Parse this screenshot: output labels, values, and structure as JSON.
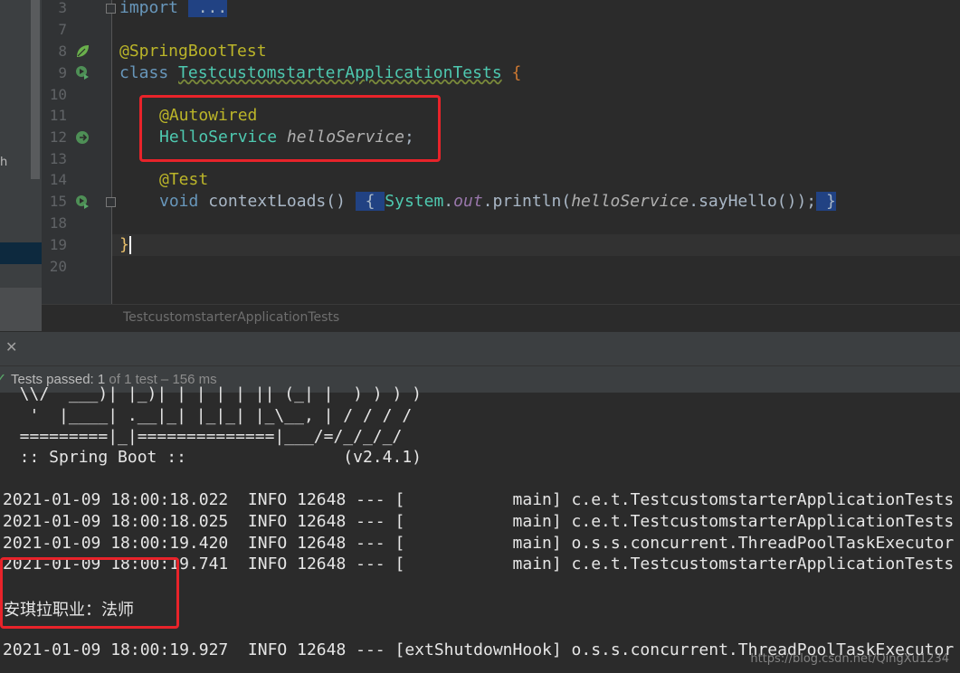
{
  "editor": {
    "line_numbers": [
      "3",
      "7",
      "8",
      "9",
      "10",
      "11",
      "12",
      "13",
      "14",
      "15",
      "18",
      "19",
      "20"
    ],
    "lines": {
      "import_kw": "import",
      "import_fold": " ...",
      "annotation_springboottest": "@SpringBootTest",
      "class_kw": "class",
      "class_name": "TestcustomstarterApplicationTests",
      "class_open": " {",
      "annotation_autowired": "@Autowired",
      "field_type": "HelloService",
      "field_name": "helloService",
      "field_semicolon": ";",
      "annotation_test": "@Test",
      "method_kw": "void",
      "method_sig": " contextLoads() ",
      "body_open": " { ",
      "system": "System",
      "dot1": ".",
      "out": "out",
      "println": ".println(",
      "call_target": "helloService",
      "call_rest": ".sayHello());",
      "body_close": " }",
      "class_close": "}"
    }
  },
  "left_panel": {
    "partial_label": "h"
  },
  "breadcrumb": "TestcustomstarterApplicationTests",
  "test_panel": {
    "close_icon_glyph": "✕",
    "check_glyph": "✓",
    "status_label": "Tests passed:",
    "status_count": " 1",
    "status_of": " of 1 test – 156 ms"
  },
  "console": {
    "banner": [
      "  \\\\/  ___)| |_)| | | | | || (_| |  ) ) ) )",
      "   '  |____| .__|_| |_|_| |_\\__, | / / / /",
      "  =========|_|==============|___/=/_/_/_/",
      "  :: Spring Boot ::                (v2.4.1)"
    ],
    "logs": [
      "2021-01-09 18:00:18.022  INFO 12648 --- [           main] c.e.t.TestcustomstarterApplicationTests",
      "2021-01-09 18:00:18.025  INFO 12648 --- [           main] c.e.t.TestcustomstarterApplicationTests",
      "2021-01-09 18:00:19.420  INFO 12648 --- [           main] o.s.s.concurrent.ThreadPoolTaskExecutor",
      "2021-01-09 18:00:19.741  INFO 12648 --- [           main] c.e.t.TestcustomstarterApplicationTests"
    ],
    "output_text": "安琪拉职业：法师",
    "shutdown_log": "2021-01-09 18:00:19.927  INFO 12648 --- [extShutdownHook] o.s.s.concurrent.ThreadPoolTaskExecutor"
  },
  "watermark": "https://blog.csdn.net/QingXu1234",
  "colors": {
    "keyword": "#cc7832",
    "annotation": "#bbb529",
    "type": "#4ec9b0",
    "highlight_box": "#e8232a",
    "test_pass": "#59a869"
  },
  "icons": {
    "spring_bean": "spring-leaf-icon",
    "run_test": "run-test-icon",
    "autowired_nav": "autowired-nav-icon"
  }
}
